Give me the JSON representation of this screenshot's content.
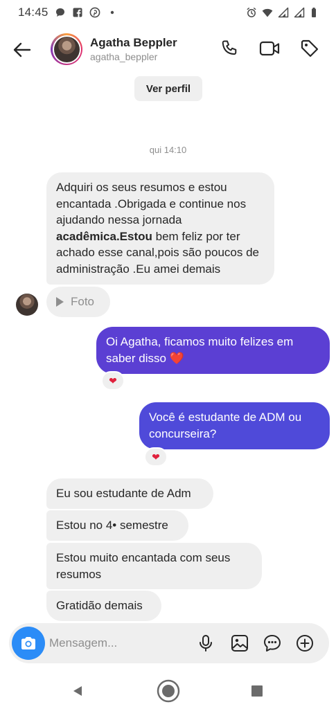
{
  "status_bar": {
    "time": "14:45",
    "left_icons": [
      "chat-bubble-icon",
      "facebook-icon",
      "pinterest-icon",
      "dot-icon"
    ],
    "right_icons": [
      "alarm-icon",
      "wifi-icon",
      "signal-icon",
      "signal-icon",
      "battery-icon"
    ]
  },
  "header": {
    "name": "Agatha Beppler",
    "username": "agatha_beppler",
    "icons": [
      "back-arrow-icon",
      "phone-icon",
      "video-icon",
      "tag-icon"
    ]
  },
  "profile_button": "Ver perfil",
  "timestamp": "qui 14:10",
  "messages": {
    "m1_part1": "Adquiri os seus resumos e estou encantada .Obrigada e continue nos ajudando nessa jornada",
    "m1_bold": "acadêmica.Estou",
    "m1_part2": "bem feliz por ter achado esse canal,pois são poucos de administração .Eu amei demais",
    "foto": "Foto",
    "out1": "Oi Agatha, ficamos muito felizes em saber disso ❤️",
    "out1_reaction": "❤",
    "out2": "Você é estudante de ADM ou concurseira?",
    "out2_reaction": "❤",
    "in2": "Eu sou estudante de Adm",
    "in3": "Estou no 4• semestre",
    "in4": "Estou muito encantada com seus resumos",
    "in5": "Gratidão demais"
  },
  "composer": {
    "placeholder": "Mensagem...",
    "icons": [
      "camera-icon",
      "microphone-icon",
      "gallery-icon",
      "sticker-icon",
      "add-icon"
    ]
  },
  "nav": {
    "icons": [
      "back-triangle-icon",
      "home-circle-icon",
      "recents-square-icon"
    ]
  },
  "colors": {
    "accent_blue": "#2b8cf7",
    "bubble_out": "#5b3fd3",
    "bubble_in": "#efefef",
    "heart": "#e0203c"
  }
}
